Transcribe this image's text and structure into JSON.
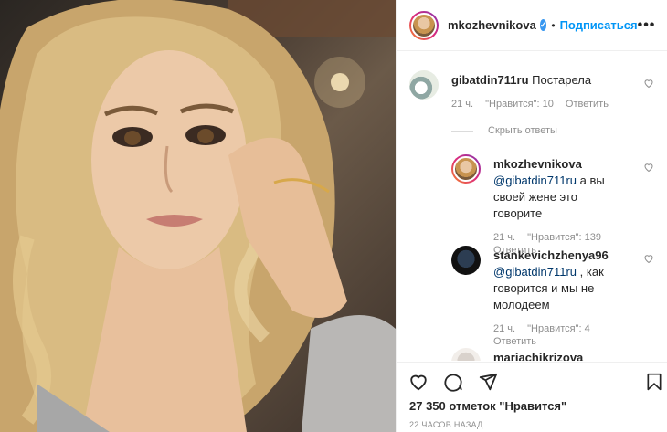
{
  "post": {
    "author": "mkozhevnikova",
    "follow_label": "Подписаться",
    "more_label": "•••"
  },
  "comments": [
    {
      "user": "gibatdin711ru",
      "text": "Постарела",
      "time": "21 ч.",
      "likes": "\"Нравится\": 10",
      "reply": "Ответить"
    }
  ],
  "hide_replies_label": "Скрыть ответы",
  "replies": [
    {
      "user": "mkozhevnikova",
      "mention": "@gibatdin711ru",
      "text": " а вы своей жене это говорите",
      "time": "21 ч.",
      "likes": "\"Нравится\": 139",
      "reply": "Ответить"
    },
    {
      "user": "stankevichzhenya96",
      "mention": "@gibatdin711ru",
      "text": " , как говорится и мы не молодеем",
      "time": "21 ч.",
      "likes": "\"Нравится\": 4",
      "reply": "Ответить"
    },
    {
      "user": "mariachikrizova"
    }
  ],
  "footer": {
    "likes_count": "27 350 отметок \"Нравится\"",
    "time_ago": "22 ЧАСОВ НАЗАД"
  },
  "colors": {
    "accent": "#0095f6",
    "verified": "#3897f0",
    "muted": "#8e8e8e"
  }
}
